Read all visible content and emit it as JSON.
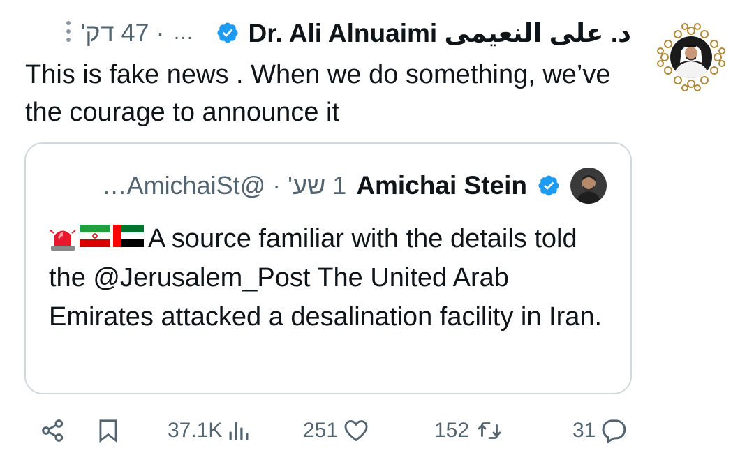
{
  "tweet": {
    "author_name": "Dr. Ali Alnuaimi د. على النعيمى",
    "time": "· 47 דק'",
    "more": "…",
    "text": "This is fake news . When we do something, we’ve the courage to announce it",
    "menu_icon": "vertical-dots-icon",
    "verified_icon": "verified-badge-icon"
  },
  "quote": {
    "author_name": "Amichai Stein",
    "handle_time": "1 שע' · @AmichaiSt…",
    "emojis": [
      "police-light-emoji",
      "iran-flag-emoji",
      "uae-flag-emoji"
    ],
    "text": "A source familiar with the details told the @Jerusalem_Post The United Arab Emirates attacked a desalination facility in Iran."
  },
  "actions": {
    "views": "37.1K",
    "likes": "251",
    "retweets": "152",
    "replies": "31",
    "icons": [
      "share-icon",
      "bookmark-icon",
      "views-icon",
      "like-icon",
      "retweet-icon",
      "reply-icon"
    ]
  },
  "colors": {
    "verified": "#1d9bf0",
    "muted": "#536471",
    "text": "#0f1419",
    "border": "#cfd9de"
  }
}
